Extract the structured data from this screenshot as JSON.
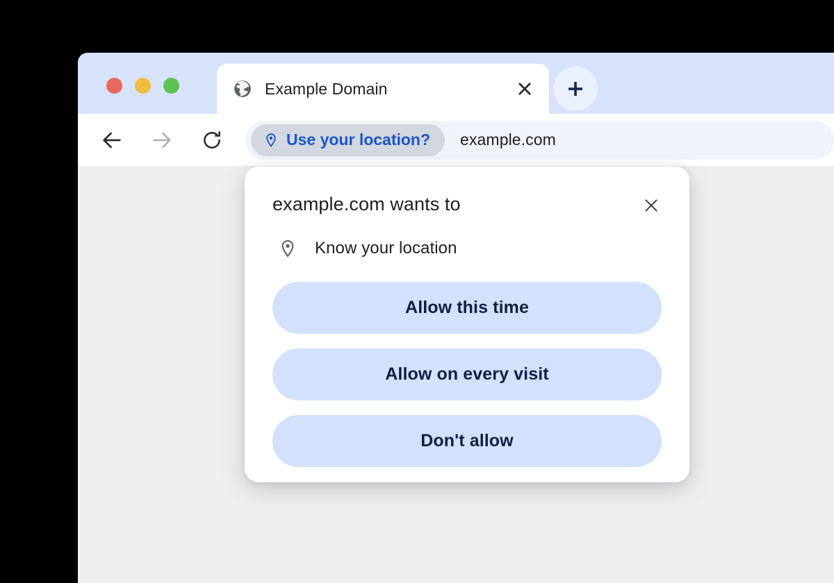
{
  "window": {
    "traffic_lights": [
      {
        "name": "close",
        "color": "#e9695c"
      },
      {
        "name": "minimize",
        "color": "#f2bc42"
      },
      {
        "name": "zoom",
        "color": "#5cc254"
      }
    ]
  },
  "tabstrip": {
    "tabs": [
      {
        "title": "Example Domain",
        "favicon": "globe-icon",
        "close_icon": "close-icon",
        "active": true
      }
    ],
    "new_tab_icon": "plus-icon"
  },
  "toolbar": {
    "back_icon": "arrow-left-icon",
    "forward_icon": "arrow-right-icon",
    "reload_icon": "reload-icon",
    "location_chip": {
      "icon": "location-pin-icon",
      "label": "Use your location?",
      "text_color": "#1a56cc",
      "background": "#d3d7e0"
    },
    "url": "example.com"
  },
  "permission_dialog": {
    "title": "example.com wants to",
    "close_icon": "close-icon",
    "permission": {
      "icon": "location-pin-icon",
      "label": "Know your location"
    },
    "buttons": [
      {
        "label": "Allow this time",
        "name": "allow-this-time"
      },
      {
        "label": "Allow on every visit",
        "name": "allow-every-visit"
      },
      {
        "label": "Don't allow",
        "name": "dont-allow"
      }
    ],
    "button_background": "#d4e1fd",
    "button_text_color": "#0f1f44"
  }
}
